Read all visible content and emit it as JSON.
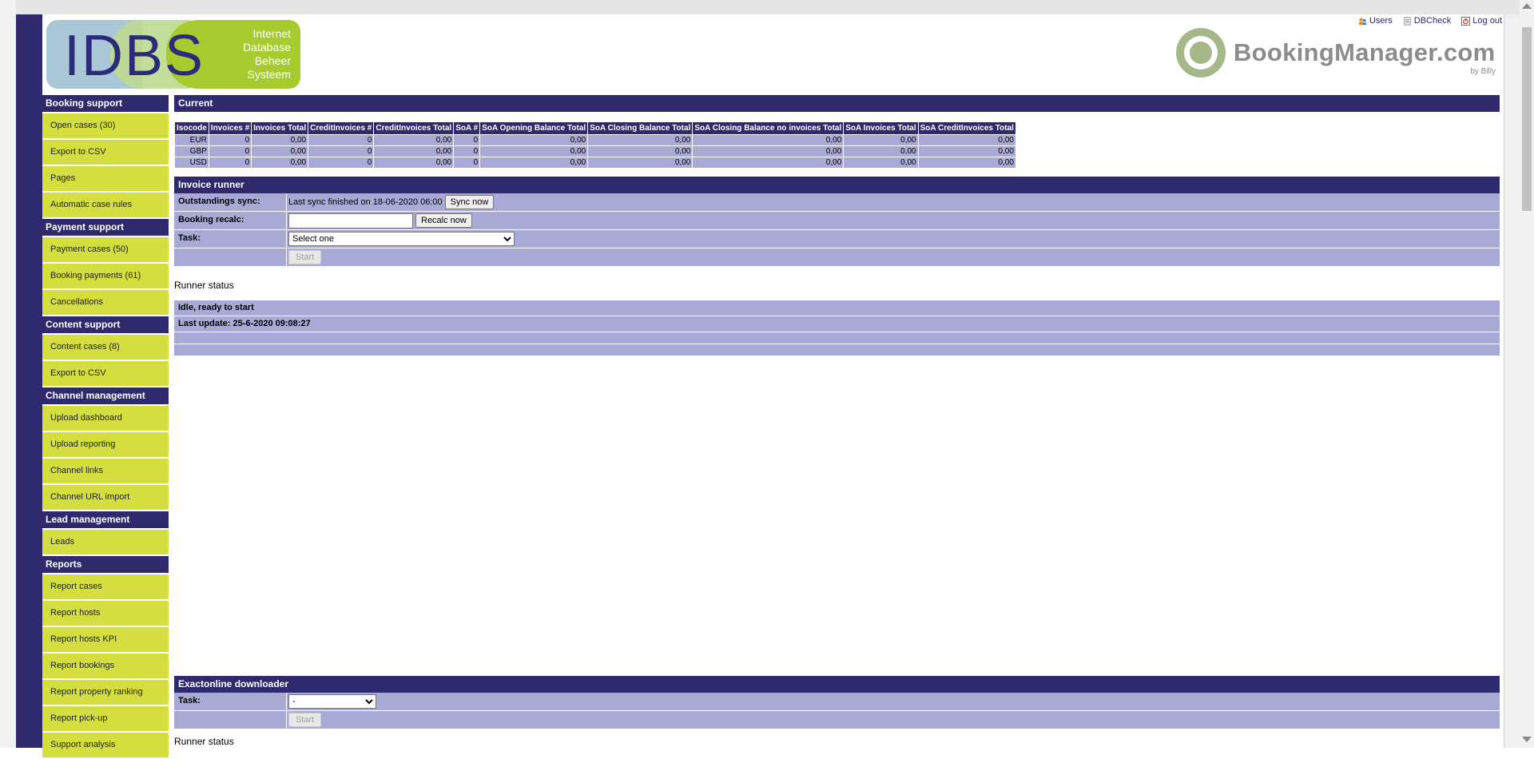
{
  "logo": {
    "letters": "IDBS",
    "tagline": [
      "Internet",
      "Database",
      "Beheer",
      "Systeem"
    ]
  },
  "brand": {
    "name": "BookingManager.com",
    "by": "by Billy"
  },
  "top_links": [
    {
      "label": "Users",
      "icon": "users-icon",
      "color": "#d9932a"
    },
    {
      "label": "DBCheck",
      "icon": "document-icon",
      "color": "#888888"
    },
    {
      "label": "Log out",
      "icon": "power-icon",
      "color": "#d23b2b"
    }
  ],
  "sidebar": [
    {
      "heading": "Booking support",
      "items": [
        "Open cases (30)",
        "Export to CSV",
        "Pages",
        "Automatic case rules"
      ]
    },
    {
      "heading": "Payment support",
      "items": [
        "Payment cases (50)",
        "Booking payments (61)",
        "Cancellations"
      ]
    },
    {
      "heading": "Content support",
      "items": [
        "Content cases (8)",
        "Export to CSV"
      ]
    },
    {
      "heading": "Channel management",
      "items": [
        "Upload dashboard",
        "Upload reporting",
        "Channel links",
        "Channel URL import"
      ]
    },
    {
      "heading": "Lead management",
      "items": [
        "Leads"
      ]
    },
    {
      "heading": "Reports",
      "items": [
        "Report cases",
        "Report hosts",
        "Report hosts KPI",
        "Report bookings",
        "Report property ranking",
        "Report pick-up",
        "Support analysis"
      ]
    }
  ],
  "current": {
    "title": "Current",
    "headers": [
      "Isocode",
      "Invoices #",
      "Invoices Total",
      "CreditInvoices #",
      "CreditInvoices Total",
      "SoA #",
      "SoA Opening Balance Total",
      "SoA Closing Balance Total",
      "SoA Closing Balance no invoices Total",
      "SoA Invoices Total",
      "SoA CreditInvoices Total"
    ],
    "rows": [
      [
        "EUR",
        "0",
        "0,00",
        "0",
        "0,00",
        "0",
        "0,00",
        "0,00",
        "0,00",
        "0,00",
        "0,00"
      ],
      [
        "GBP",
        "0",
        "0,00",
        "0",
        "0,00",
        "0",
        "0,00",
        "0,00",
        "0,00",
        "0,00",
        "0,00"
      ],
      [
        "USD",
        "0",
        "0,00",
        "0",
        "0,00",
        "0",
        "0,00",
        "0,00",
        "0,00",
        "0,00",
        "0,00"
      ]
    ]
  },
  "invoice_runner": {
    "title": "Invoice runner",
    "outstandings_label": "Outstandings sync:",
    "outstandings_text": "Last sync finished on 18-06-2020 06:00",
    "sync_button": "Sync now",
    "recalc_label": "Booking recalc:",
    "recalc_value": "",
    "recalc_button": "Recalc now",
    "task_label": "Task:",
    "task_selected": "Select one",
    "start_button": "Start",
    "runner_status_title": "Runner status",
    "status_lines": [
      "Idle, ready to start",
      "Last update: 25-6-2020 09:08:27"
    ]
  },
  "exactonline": {
    "title": "Exactonline downloader",
    "task_label": "Task:",
    "task_selected": "-",
    "start_button": "Start",
    "runner_status_title": "Runner status"
  }
}
